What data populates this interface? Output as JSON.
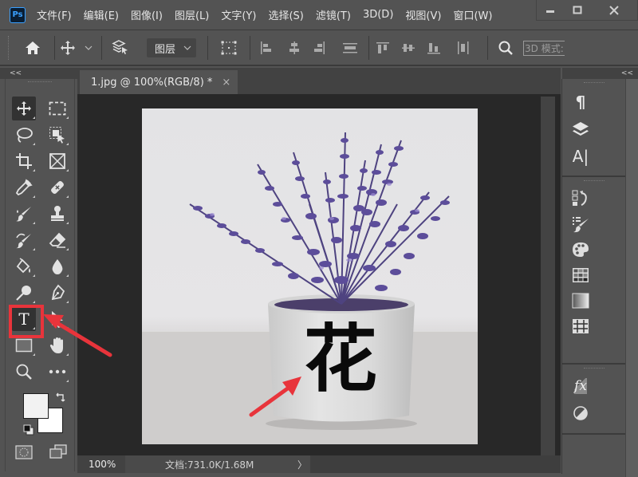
{
  "app": {
    "logo_text": "Ps",
    "menu": [
      "文件(F)",
      "编辑(E)",
      "图像(I)",
      "图层(L)",
      "文字(Y)",
      "选择(S)",
      "滤镜(T)",
      "3D(D)",
      "视图(V)",
      "窗口(W)"
    ],
    "window_controls": {
      "minimize": "minimize-icon",
      "maximize": "maximize-icon",
      "close": "close-icon"
    }
  },
  "options_bar": {
    "home_icon": "home-icon",
    "move_icon": "move-icon",
    "auto_select_icon": "layer-select-icon",
    "layer_dropdown": "图层",
    "transform_controls_icon": "transform-controls-icon",
    "align_icons": [
      "align-left-icon",
      "align-hcenter-icon",
      "align-right-icon",
      "align-vcenter-distribute-icon",
      "align-top-icon",
      "align-vmiddle-icon",
      "align-bottom-icon",
      "distribute-icon"
    ],
    "search_icon": "search-icon",
    "mode_3d_label": "3D 模式:"
  },
  "left_panel": {
    "collapse_label": "<<",
    "tools": [
      {
        "name": "move-tool",
        "active": true
      },
      {
        "name": "rectangular-marquee-tool"
      },
      {
        "name": "lasso-tool"
      },
      {
        "name": "object-selection-tool"
      },
      {
        "name": "crop-tool"
      },
      {
        "name": "frame-tool"
      },
      {
        "name": "eyedropper-tool"
      },
      {
        "name": "spot-healing-brush-tool"
      },
      {
        "name": "brush-tool"
      },
      {
        "name": "clone-stamp-tool"
      },
      {
        "name": "history-brush-tool"
      },
      {
        "name": "eraser-tool"
      },
      {
        "name": "paint-bucket-tool"
      },
      {
        "name": "blur-tool"
      },
      {
        "name": "dodge-tool"
      },
      {
        "name": "pen-tool"
      },
      {
        "name": "horizontal-type-tool",
        "highlighted": true
      },
      {
        "name": "path-selection-tool"
      },
      {
        "name": "rectangle-tool"
      },
      {
        "name": "hand-tool"
      },
      {
        "name": "zoom-tool"
      },
      {
        "name": "edit-toolbar"
      }
    ],
    "foreground_color": "#f2f2f2",
    "background_color": "#ffffff",
    "type_tool_glyph": "T"
  },
  "document": {
    "tab_title": "1.jpg @ 100%(RGB/8) *",
    "tab_close": "×",
    "zoom": "100%",
    "doc_info": "文档:731.0K/1.68M",
    "status_chevron": "〉",
    "overlay_text": "花",
    "highlight_color": "#e8343b"
  },
  "right_panel": {
    "collapse_label": "<<",
    "groups": [
      [
        "paragraph-icon",
        "layers-icon",
        "character-icon"
      ],
      [
        "history-icon",
        "brush-settings-icon",
        "color-icon",
        "swatches-icon",
        "gradients-icon",
        "patterns-icon"
      ],
      [
        "styles-icon",
        "adjustments-icon"
      ]
    ]
  }
}
